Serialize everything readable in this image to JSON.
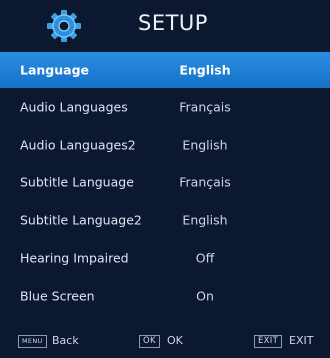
{
  "header": {
    "title": "SETUP",
    "icon": "gear-icon",
    "accent": "#1e82d8"
  },
  "menu": {
    "items": [
      {
        "label": "Language",
        "value": "English",
        "selected": true
      },
      {
        "label": "Audio Languages",
        "value": "Français",
        "selected": false
      },
      {
        "label": "Audio Languages2",
        "value": "English",
        "selected": false
      },
      {
        "label": "Subtitle Language",
        "value": "Français",
        "selected": false
      },
      {
        "label": "Subtitle Language2",
        "value": "English",
        "selected": false
      },
      {
        "label": "Hearing Impaired",
        "value": "Off",
        "selected": false
      },
      {
        "label": "Blue Screen",
        "value": "On",
        "selected": false
      }
    ]
  },
  "footer": {
    "back_key": "MENU",
    "back_label": "Back",
    "ok_key": "OK",
    "ok_label": "OK",
    "exit_key": "EXIT",
    "exit_label": "EXIT"
  }
}
